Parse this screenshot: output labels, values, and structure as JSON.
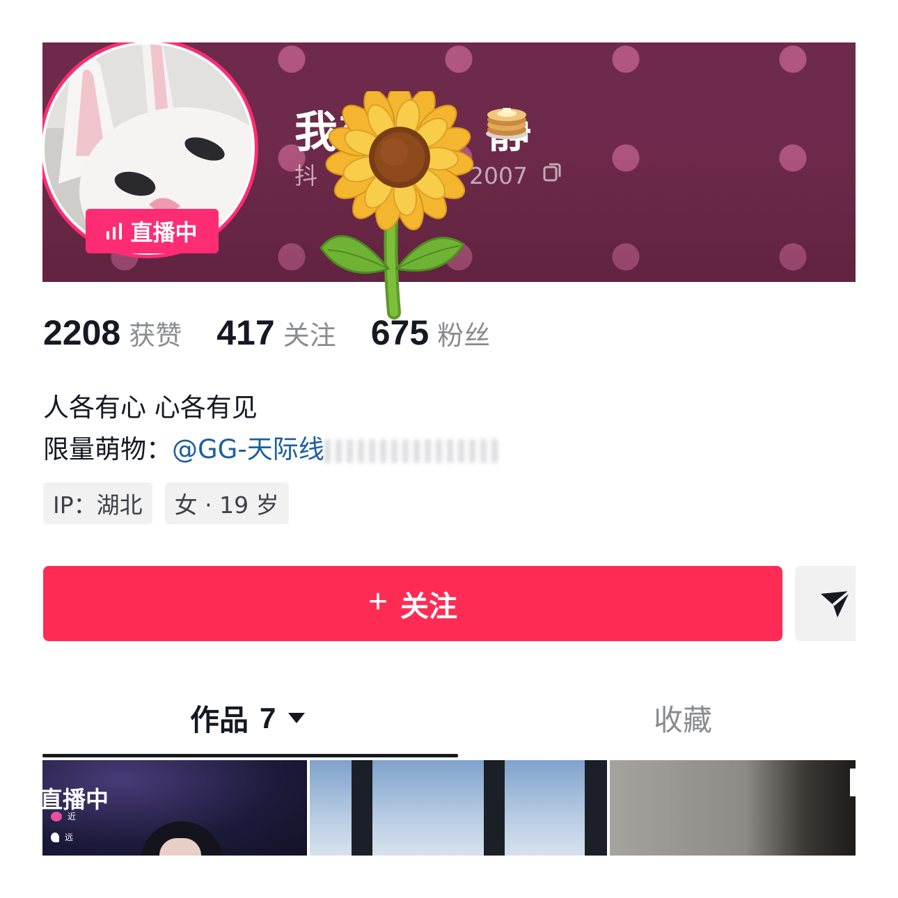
{
  "profile": {
    "username_visible": "我想",
    "username_end": "静",
    "douyin_id_prefix": "抖",
    "douyin_id_suffix": "2007",
    "live_label": "直播中"
  },
  "stats": [
    {
      "value": "2208",
      "label": "获赞"
    },
    {
      "value": "417",
      "label": "关注"
    },
    {
      "value": "675",
      "label": "粉丝"
    }
  ],
  "bio": {
    "line1": "人各有心 心各有见",
    "line2_prefix": "限量萌物：",
    "mention": "@GG-天际线"
  },
  "tags": [
    "IP：湖北",
    "女 · 19 岁"
  ],
  "actions": {
    "follow_plus": "+",
    "follow_label": "关注"
  },
  "tabs": {
    "works_label": "作品",
    "works_count": "7",
    "favorites_label": "收藏"
  },
  "grid": {
    "first_overlay": "直播中",
    "first_mini1": "近",
    "first_mini2": "远"
  },
  "colors": {
    "brand_red": "#fe2c55",
    "live_pink": "#fe2c73",
    "header_bg": "#6e2a4a",
    "mention_blue": "#1b5fa1"
  },
  "icons": [
    "live-bars-icon",
    "pancake-badge-icon",
    "copy-icon",
    "send-icon",
    "caret-down-icon",
    "sunflower-sticker"
  ]
}
